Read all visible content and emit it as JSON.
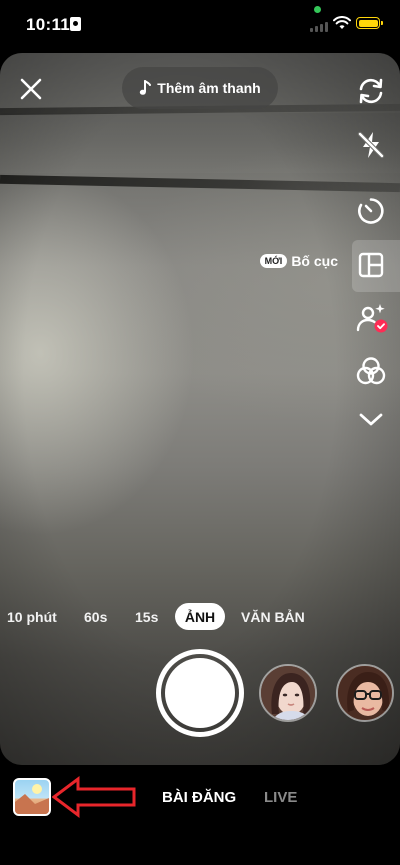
{
  "status_bar": {
    "time": "10:11"
  },
  "top_bar": {
    "add_sound_label": "Thêm âm thanh"
  },
  "side_tools": {
    "layout_new_badge": "MỚI",
    "layout_label": "Bố cục"
  },
  "capture_modes": {
    "items": [
      "10 phút",
      "60s",
      "15s",
      "ẢNH",
      "VĂN BẢN"
    ],
    "selected": "ẢNH"
  },
  "bottom_tabs": {
    "post": "BÀI ĐĂNG",
    "live": "LIVE"
  },
  "colors": {
    "accent_battery": "#ffd60a",
    "badge_red": "#fe2c55",
    "annotation_arrow": "#e8262b"
  },
  "icons": [
    "close-icon",
    "music-note-icon",
    "flip-camera-icon",
    "flash-off-icon",
    "timer-icon",
    "layout-icon",
    "beauty-icon",
    "filters-icon",
    "chevron-down-icon",
    "gallery-icon"
  ]
}
